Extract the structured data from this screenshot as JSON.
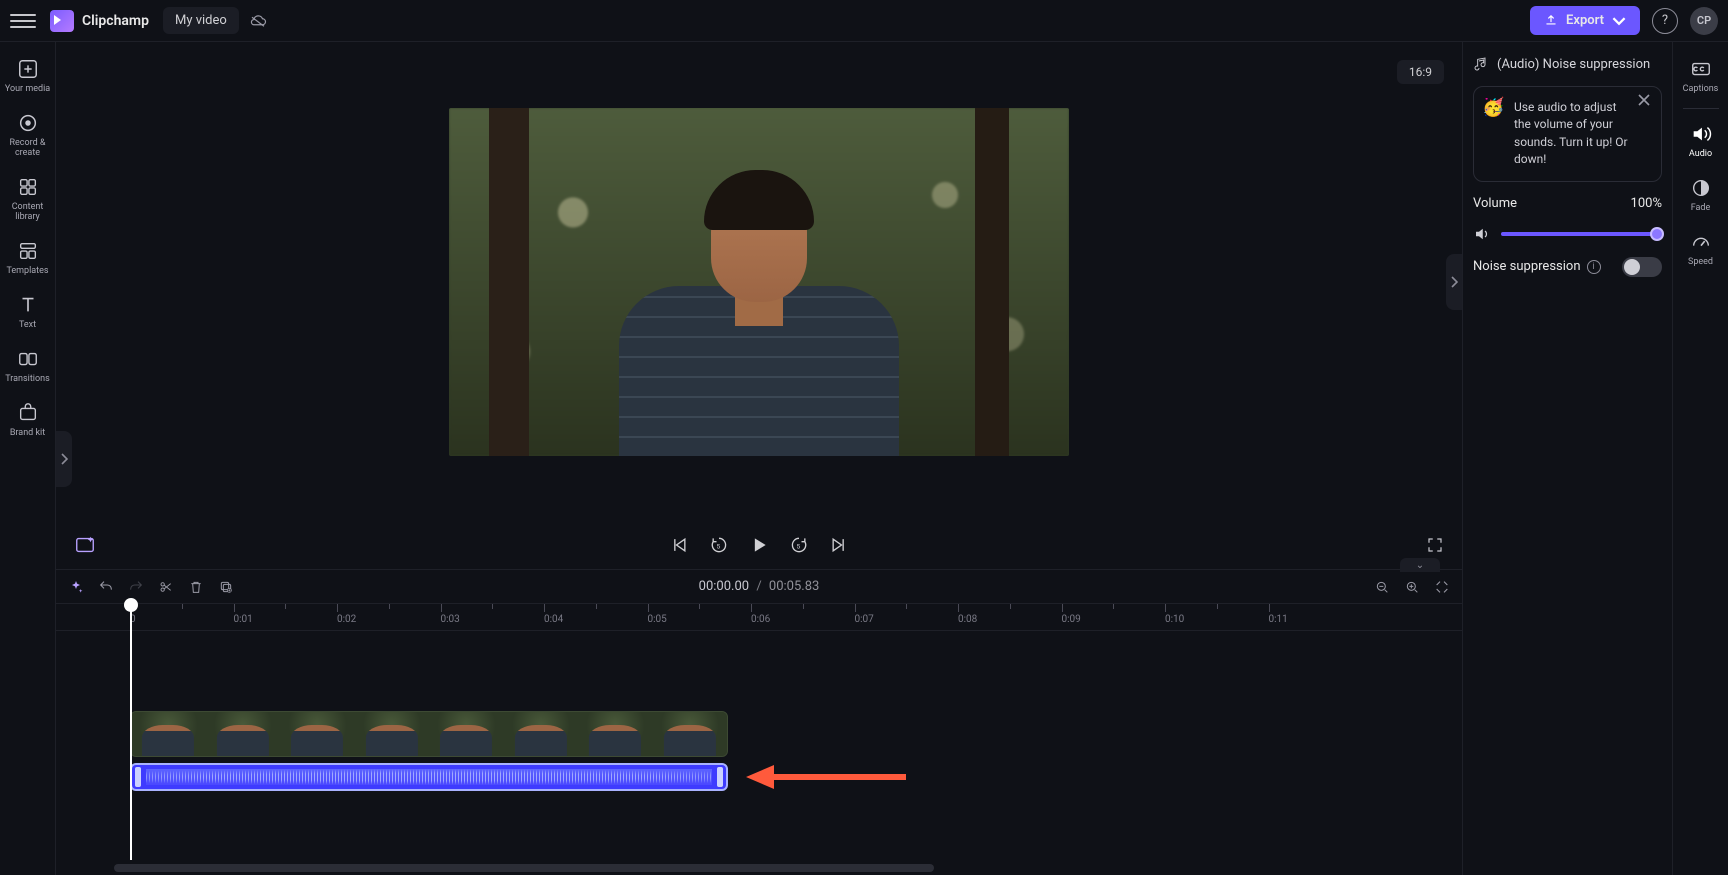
{
  "app": {
    "brand": "Clipchamp",
    "project": "My video",
    "avatar": "CP"
  },
  "topbar": {
    "export": "Export"
  },
  "aspect": "16:9",
  "left_tools": [
    {
      "id": "your-media",
      "label": "Your media"
    },
    {
      "id": "record-create",
      "label": "Record & create"
    },
    {
      "id": "content-library",
      "label": "Content library"
    },
    {
      "id": "templates",
      "label": "Templates"
    },
    {
      "id": "text",
      "label": "Text"
    },
    {
      "id": "transitions",
      "label": "Transitions"
    },
    {
      "id": "brand-kit",
      "label": "Brand kit"
    }
  ],
  "right_tools": [
    {
      "id": "captions",
      "label": "Captions"
    },
    {
      "id": "audio",
      "label": "Audio"
    },
    {
      "id": "fade",
      "label": "Fade"
    },
    {
      "id": "speed",
      "label": "Speed"
    }
  ],
  "playback": {
    "current": "00:00.00",
    "separator": "/",
    "total": "00:05.83"
  },
  "ruler": {
    "start": 0,
    "ticks": [
      "0",
      "0:01",
      "0:02",
      "0:03",
      "0:04",
      "0:05",
      "0:06",
      "0:07",
      "0:08",
      "0:09",
      "0:10",
      "0:11"
    ]
  },
  "panel": {
    "title": "(Audio) Noise suppression",
    "tip": "Use audio to adjust the volume of your sounds. Turn it up! Or down!",
    "volume_label": "Volume",
    "volume_value": "100%",
    "noise_label": "Noise suppression",
    "noise_on": false
  },
  "colors": {
    "accent": "#6b57ff",
    "audio_clip": "#3e3bff",
    "arrow": "#ff5a3c"
  }
}
